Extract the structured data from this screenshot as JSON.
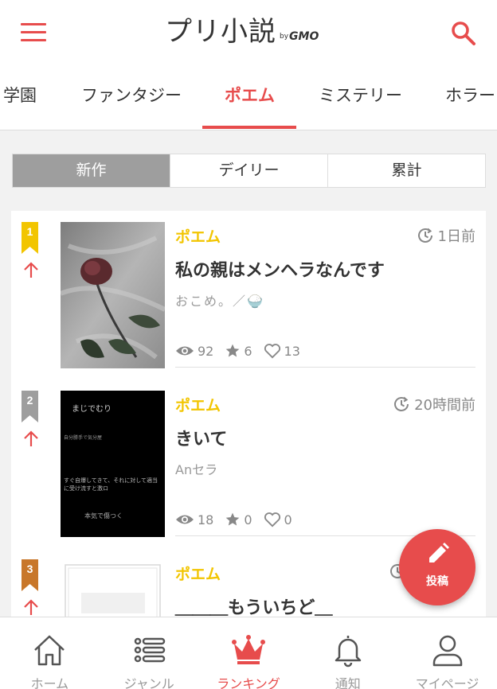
{
  "header": {
    "logo_main": "プリ小説",
    "logo_by": "by",
    "logo_brand": "GMO"
  },
  "genre_tabs": [
    {
      "label": "学園"
    },
    {
      "label": "ファンタジー"
    },
    {
      "label": "ポエム"
    },
    {
      "label": "ミステリー"
    },
    {
      "label": "ホラー"
    }
  ],
  "segments": [
    {
      "label": "新作"
    },
    {
      "label": "デイリー"
    },
    {
      "label": "累計"
    }
  ],
  "ranking": [
    {
      "rank": "1",
      "rank_color": "#f2c500",
      "genre": "ポエム",
      "time": "1日前",
      "title": "私の親はメンヘラなんです",
      "author": "おこめ。／🍚",
      "views": "92",
      "stars": "6",
      "hearts": "13"
    },
    {
      "rank": "2",
      "rank_color": "#9e9e9e",
      "genre": "ポエム",
      "time": "20時間前",
      "title": "きいて",
      "author": "Anセラ",
      "views": "18",
      "stars": "0",
      "hearts": "0",
      "cover_lines": [
        "まじでむり",
        "自分勝手で気分屋",
        "すぐ自爆してきて、それに対して適当に受け流すと激ロ",
        "本気で傷つく"
      ]
    },
    {
      "rank": "3",
      "rank_color": "#c8772a",
      "genre": "ポエム",
      "title": "＿＿＿もういちど＿"
    }
  ],
  "fab": {
    "label": "投稿"
  },
  "bottom_nav": [
    {
      "label": "ホーム"
    },
    {
      "label": "ジャンル"
    },
    {
      "label": "ランキング"
    },
    {
      "label": "通知"
    },
    {
      "label": "マイページ"
    }
  ],
  "colors": {
    "accent": "#e74c4c",
    "genre": "#f2c500",
    "rank1": "#f2c500",
    "rank2": "#9e9e9e",
    "rank3": "#c8772a"
  }
}
